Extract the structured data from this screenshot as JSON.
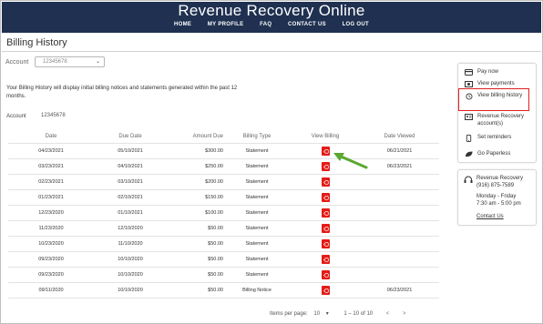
{
  "header": {
    "brand": "Revenue Recovery Online",
    "nav": [
      "HOME",
      "MY PROFILE",
      "FAQ",
      "CONTACT US",
      "LOG OUT"
    ]
  },
  "page_title": "Billing History",
  "account_select": {
    "label": "Account",
    "value": "12345678"
  },
  "info_text": "Your Billing History will display initial billing notices and statements generated within the past 12 months.",
  "account_line": {
    "label": "Account",
    "value": "12345678"
  },
  "table": {
    "headers": [
      "Date",
      "Due Date",
      "Amount Due",
      "Billing Type",
      "View Billing",
      "Date Viewed"
    ],
    "rows": [
      [
        "04/23/2021",
        "05/10/2021",
        "$300.00",
        "Statement",
        "06/21/2021"
      ],
      [
        "03/23/2021",
        "04/10/2021",
        "$250.00",
        "Statement",
        "06/23/2021"
      ],
      [
        "02/23/2021",
        "03/10/2021",
        "$200.00",
        "Statement",
        ""
      ],
      [
        "01/23/2021",
        "02/10/2021",
        "$150.00",
        "Statement",
        ""
      ],
      [
        "12/23/2020",
        "01/10/2021",
        "$100.00",
        "Statement",
        ""
      ],
      [
        "11/23/2020",
        "12/10/2020",
        "$50.00",
        "Statement",
        ""
      ],
      [
        "10/23/2020",
        "11/10/2020",
        "$50.00",
        "Statement",
        ""
      ],
      [
        "09/23/2020",
        "10/10/2020",
        "$50.00",
        "Statement",
        ""
      ],
      [
        "09/23/2020",
        "10/10/2020",
        "$50.00",
        "Statement",
        ""
      ],
      [
        "09/11/2020",
        "10/10/2020",
        "$50.00",
        "Billing Notice",
        "06/23/2021"
      ]
    ]
  },
  "pager": {
    "label": "Items per page:",
    "per_page": "10",
    "range": "1 – 10 of 10",
    "prev": "<",
    "next": ">"
  },
  "side_menu": [
    {
      "icon": "wallet-icon",
      "label": "Pay now"
    },
    {
      "icon": "money-icon",
      "label": "View payments"
    },
    {
      "icon": "history-icon",
      "label": "View billing history"
    },
    {
      "icon": "id-card-icon",
      "label": "Revenue Recovery account(s)"
    },
    {
      "icon": "phone-icon",
      "label": "Set reminders"
    },
    {
      "icon": "leaf-icon",
      "label": "Go Paperless"
    }
  ],
  "contact": {
    "name": "Revenue Recovery",
    "phone": "(916) 875-7589",
    "days": "Monday - Friday",
    "hours": "7:30 am - 5:00 pm",
    "link": "Contact Us"
  },
  "colors": {
    "header_bg": "#1f3050",
    "pdf_red": "#e41b17",
    "highlight": "#e02020",
    "arrow": "#5aa832"
  }
}
